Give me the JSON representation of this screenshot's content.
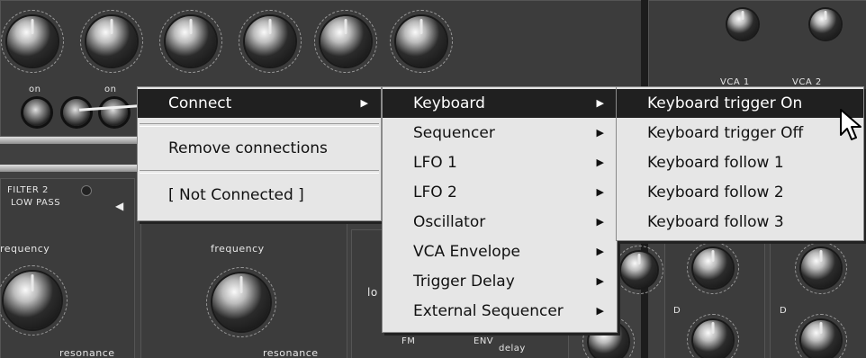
{
  "synth": {
    "switch_label_1": "on",
    "switch_label_2": "on",
    "filter_title": "FILTER 2",
    "filter_mode": "LOW PASS",
    "knob_label_frequency_1": "requency",
    "knob_label_frequency_2": "frequency",
    "knob_label_resonance_1": "resonance",
    "knob_label_resonance_2": "resonance",
    "vca_label_1": "VCA 1",
    "vca_label_2": "VCA 2",
    "fm_label": "FM",
    "env_label": "ENV",
    "env_sub": "delay",
    "lo_label": "lo",
    "d_label_1": "D",
    "d_label_2": "D"
  },
  "context_menu": {
    "items": [
      {
        "label": "Connect",
        "submenu": true,
        "selected": true
      },
      {
        "label": "Remove connections"
      },
      {
        "label": "[ Not Connected ]"
      }
    ]
  },
  "source_menu": {
    "items": [
      {
        "label": "Keyboard",
        "submenu": true,
        "selected": true
      },
      {
        "label": "Sequencer",
        "submenu": true
      },
      {
        "label": "LFO 1",
        "submenu": true
      },
      {
        "label": "LFO 2",
        "submenu": true
      },
      {
        "label": "Oscillator",
        "submenu": true
      },
      {
        "label": "VCA Envelope",
        "submenu": true
      },
      {
        "label": "Trigger Delay",
        "submenu": true
      },
      {
        "label": "External Sequencer",
        "submenu": true
      }
    ]
  },
  "keyboard_menu": {
    "items": [
      {
        "label": "Keyboard trigger On",
        "selected": true
      },
      {
        "label": "Keyboard trigger Off"
      },
      {
        "label": "Keyboard follow 1"
      },
      {
        "label": "Keyboard follow 2"
      },
      {
        "label": "Keyboard follow 3"
      }
    ]
  },
  "icons": {
    "submenu_arrow": "triangle-right",
    "cursor": "arrow-pointer"
  },
  "colors": {
    "menu_bg": "#e6e6e6",
    "selection_bg": "#202020",
    "panel_bg": "#404040"
  }
}
